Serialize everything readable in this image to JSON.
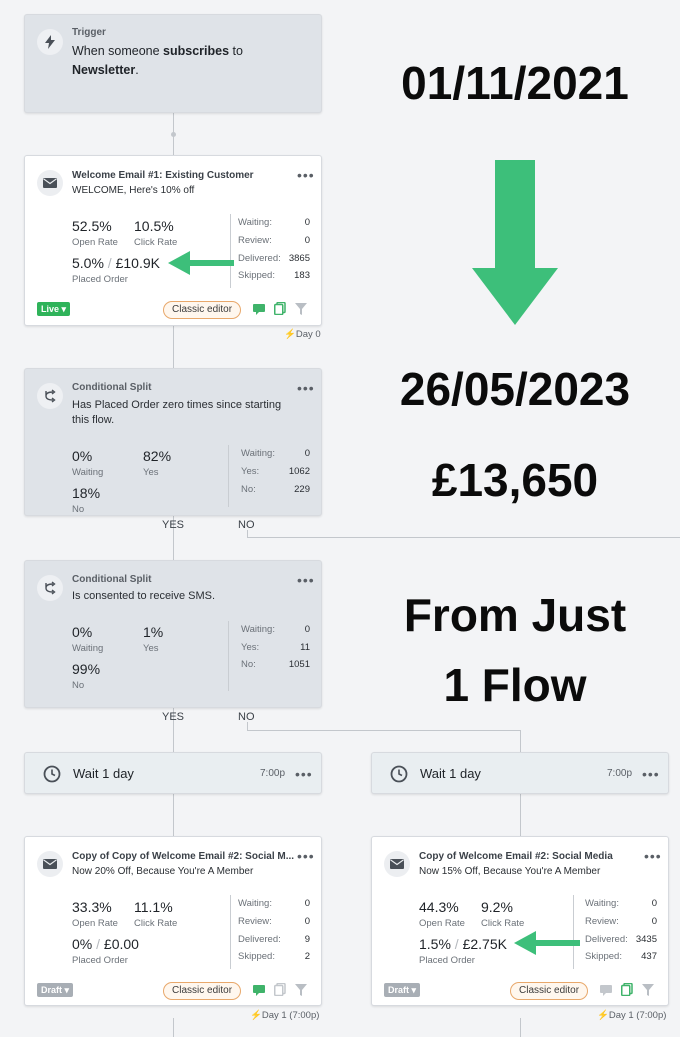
{
  "trigger": {
    "title": "Trigger",
    "text_plain": "When someone ",
    "text_bold1": "subscribes",
    "text_mid": " to",
    "text_bold2": "Newsletter",
    "text_end": "."
  },
  "email1": {
    "title": "Welcome Email #1: Existing Customer",
    "subject": "WELCOME, Here's 10% off",
    "open_rate": "52.5%",
    "open_rate_label": "Open Rate",
    "click_rate": "10.5%",
    "click_rate_label": "Click Rate",
    "placed_pct": "5.0%",
    "placed_value": "£10.9K",
    "placed_label": "Placed Order",
    "stats": [
      {
        "key": "Waiting:",
        "val": "0"
      },
      {
        "key": "Review:",
        "val": "0"
      },
      {
        "key": "Delivered:",
        "val": "3865"
      },
      {
        "key": "Skipped:",
        "val": "183"
      }
    ],
    "status": "Live",
    "editor": "Classic editor",
    "day": "Day 0"
  },
  "split1": {
    "title": "Conditional Split",
    "line1": "Has Placed Order zero times since starting",
    "line2": "this flow.",
    "waiting_pct": "0%",
    "waiting_label": "Waiting",
    "yes_pct": "82%",
    "yes_label": "Yes",
    "no_pct": "18%",
    "no_label": "No",
    "stats": [
      {
        "key": "Waiting:",
        "val": "0"
      },
      {
        "key": "Yes:",
        "val": "1062"
      },
      {
        "key": "No:",
        "val": "229"
      }
    ],
    "yes_branch": "YES",
    "no_branch": "NO"
  },
  "split2": {
    "title": "Conditional Split",
    "line1": "Is consented to receive SMS.",
    "waiting_pct": "0%",
    "waiting_label": "Waiting",
    "yes_pct": "1%",
    "yes_label": "Yes",
    "no_pct": "99%",
    "no_label": "No",
    "stats": [
      {
        "key": "Waiting:",
        "val": "0"
      },
      {
        "key": "Yes:",
        "val": "11"
      },
      {
        "key": "No:",
        "val": "1051"
      }
    ],
    "yes_branch": "YES",
    "no_branch": "NO"
  },
  "wait_left": {
    "label": "Wait 1 day",
    "time": "7:00p"
  },
  "wait_right": {
    "label": "Wait 1 day",
    "time": "7:00p"
  },
  "email_left": {
    "title": "Copy of Copy of Welcome Email #2: Social M...",
    "subject": "Now 20% Off, Because You're A Member",
    "open_rate": "33.3%",
    "open_rate_label": "Open Rate",
    "click_rate": "11.1%",
    "click_rate_label": "Click Rate",
    "placed_pct": "0%",
    "placed_value": "£0.00",
    "placed_label": "Placed Order",
    "stats": [
      {
        "key": "Waiting:",
        "val": "0"
      },
      {
        "key": "Review:",
        "val": "0"
      },
      {
        "key": "Delivered:",
        "val": "9"
      },
      {
        "key": "Skipped:",
        "val": "2"
      }
    ],
    "status": "Draft",
    "editor": "Classic editor",
    "day": "Day 1 (7:00p)"
  },
  "email_right": {
    "title": "Copy of Welcome Email #2: Social Media",
    "subject": "Now 15% Off, Because You're A Member",
    "open_rate": "44.3%",
    "open_rate_label": "Open Rate",
    "click_rate": "9.2%",
    "click_rate_label": "Click Rate",
    "placed_pct": "1.5%",
    "placed_value": "£2.75K",
    "placed_label": "Placed Order",
    "stats": [
      {
        "key": "Waiting:",
        "val": "0"
      },
      {
        "key": "Review:",
        "val": "0"
      },
      {
        "key": "Delivered:",
        "val": "3435"
      },
      {
        "key": "Skipped:",
        "val": "437"
      }
    ],
    "status": "Draft",
    "editor": "Classic editor",
    "day": "Day 1 (7:00p)"
  },
  "overlay": {
    "start_date": "01/11/2021",
    "end_date": "26/05/2023",
    "revenue": "£13,650",
    "caption_line1": "From Just",
    "caption_line2": "1 Flow"
  },
  "colors": {
    "arrow_green": "#3dbf7a",
    "live_green": "#2fb35a",
    "pill_border": "#e8a86b"
  }
}
